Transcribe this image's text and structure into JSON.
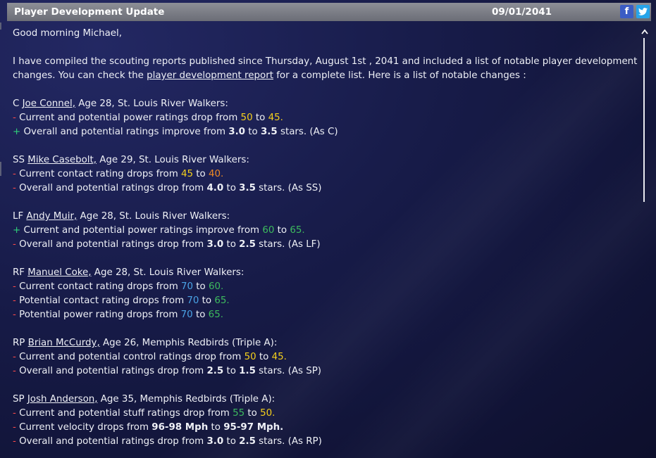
{
  "window": {
    "title": "Player Development Update",
    "date": "09/01/2041",
    "facebook_icon": "f",
    "twitter_icon": "bird"
  },
  "message": {
    "greeting": "Good morning Michael,",
    "intro_1": "I have compiled the scouting reports published since Thursday, August 1st , 2041 and included a list of notable player development",
    "intro_2_pre": "changes. You can check the ",
    "intro_link": "player development report",
    "intro_2_post": " for a complete list. Here is a list of notable changes :"
  },
  "players": [
    {
      "pos": "C ",
      "name": "Joe Connel,",
      "info": " Age 28, St. Louis River Walkers:",
      "changes": [
        {
          "sign": "-",
          "segs": [
            {
              "t": " Current and potential power ratings drop from "
            },
            {
              "t": "50",
              "c": "yellow"
            },
            {
              "t": " to "
            },
            {
              "t": "45.",
              "c": "yellow"
            }
          ]
        },
        {
          "sign": "+",
          "segs": [
            {
              "t": " Overall and potential ratings improve from "
            },
            {
              "t": "3.0",
              "b": true
            },
            {
              "t": " to "
            },
            {
              "t": "3.5",
              "b": true
            },
            {
              "t": " stars. (As C)"
            }
          ]
        }
      ]
    },
    {
      "pos": "SS ",
      "name": "Mike Casebolt,",
      "info": " Age 29, St. Louis River Walkers:",
      "changes": [
        {
          "sign": "-",
          "segs": [
            {
              "t": " Current contact rating drops from "
            },
            {
              "t": "45",
              "c": "yellow"
            },
            {
              "t": " to "
            },
            {
              "t": "40.",
              "c": "orange"
            }
          ]
        },
        {
          "sign": "-",
          "segs": [
            {
              "t": " Overall and potential ratings drop from "
            },
            {
              "t": "4.0",
              "b": true
            },
            {
              "t": " to "
            },
            {
              "t": "3.5",
              "b": true
            },
            {
              "t": " stars. (As SS)"
            }
          ]
        }
      ]
    },
    {
      "pos": "LF ",
      "name": "Andy Muir,",
      "info": " Age 28, St. Louis River Walkers:",
      "changes": [
        {
          "sign": "+",
          "segs": [
            {
              "t": " Current and potential power ratings improve from "
            },
            {
              "t": "60",
              "c": "green"
            },
            {
              "t": " to "
            },
            {
              "t": "65.",
              "c": "green"
            }
          ]
        },
        {
          "sign": "-",
          "segs": [
            {
              "t": " Overall and potential ratings drop from "
            },
            {
              "t": "3.0",
              "b": true
            },
            {
              "t": " to "
            },
            {
              "t": "2.5",
              "b": true
            },
            {
              "t": " stars. (As LF)"
            }
          ]
        }
      ]
    },
    {
      "pos": "RF ",
      "name": "Manuel Coke,",
      "info": " Age 28, St. Louis River Walkers:",
      "changes": [
        {
          "sign": "-",
          "segs": [
            {
              "t": " Current contact rating drops from "
            },
            {
              "t": "70",
              "c": "blue"
            },
            {
              "t": " to "
            },
            {
              "t": "60.",
              "c": "green"
            }
          ]
        },
        {
          "sign": "-",
          "segs": [
            {
              "t": " Potential contact rating drops from "
            },
            {
              "t": "70",
              "c": "blue"
            },
            {
              "t": " to "
            },
            {
              "t": "65.",
              "c": "green"
            }
          ]
        },
        {
          "sign": "-",
          "segs": [
            {
              "t": " Potential power rating drops from "
            },
            {
              "t": "70",
              "c": "blue"
            },
            {
              "t": " to "
            },
            {
              "t": "65.",
              "c": "green"
            }
          ]
        }
      ]
    },
    {
      "pos": "RP ",
      "name": "Brian McCurdy,",
      "info": " Age 26, Memphis Redbirds (Triple A):",
      "changes": [
        {
          "sign": "-",
          "segs": [
            {
              "t": " Current and potential control ratings drop from "
            },
            {
              "t": "50",
              "c": "yellow"
            },
            {
              "t": " to "
            },
            {
              "t": "45.",
              "c": "yellow"
            }
          ]
        },
        {
          "sign": "-",
          "segs": [
            {
              "t": " Overall and potential ratings drop from "
            },
            {
              "t": "2.5",
              "b": true
            },
            {
              "t": " to "
            },
            {
              "t": "1.5",
              "b": true
            },
            {
              "t": " stars. (As SP)"
            }
          ]
        }
      ]
    },
    {
      "pos": "SP ",
      "name": "Josh Anderson,",
      "info": " Age 35, Memphis Redbirds (Triple A):",
      "changes": [
        {
          "sign": "-",
          "segs": [
            {
              "t": " Current and potential stuff ratings drop from "
            },
            {
              "t": "55",
              "c": "green"
            },
            {
              "t": " to "
            },
            {
              "t": "50.",
              "c": "yellow"
            }
          ]
        },
        {
          "sign": "-",
          "segs": [
            {
              "t": " Current velocity drops from "
            },
            {
              "t": "96-98 Mph",
              "b": true
            },
            {
              "t": " to "
            },
            {
              "t": "95-97 Mph.",
              "b": true
            }
          ]
        },
        {
          "sign": "-",
          "segs": [
            {
              "t": " Overall and potential ratings drop from "
            },
            {
              "t": "3.0",
              "b": true
            },
            {
              "t": " to "
            },
            {
              "t": "2.5",
              "b": true
            },
            {
              "t": " stars. (As RP)"
            }
          ]
        }
      ]
    }
  ],
  "colors": {
    "yellow": "#f5d01c",
    "orange": "#f08a24",
    "green": "#3dbb5e",
    "blue": "#4aa3e6",
    "minus": "#ff4a4a",
    "plus": "#2fd07a"
  }
}
